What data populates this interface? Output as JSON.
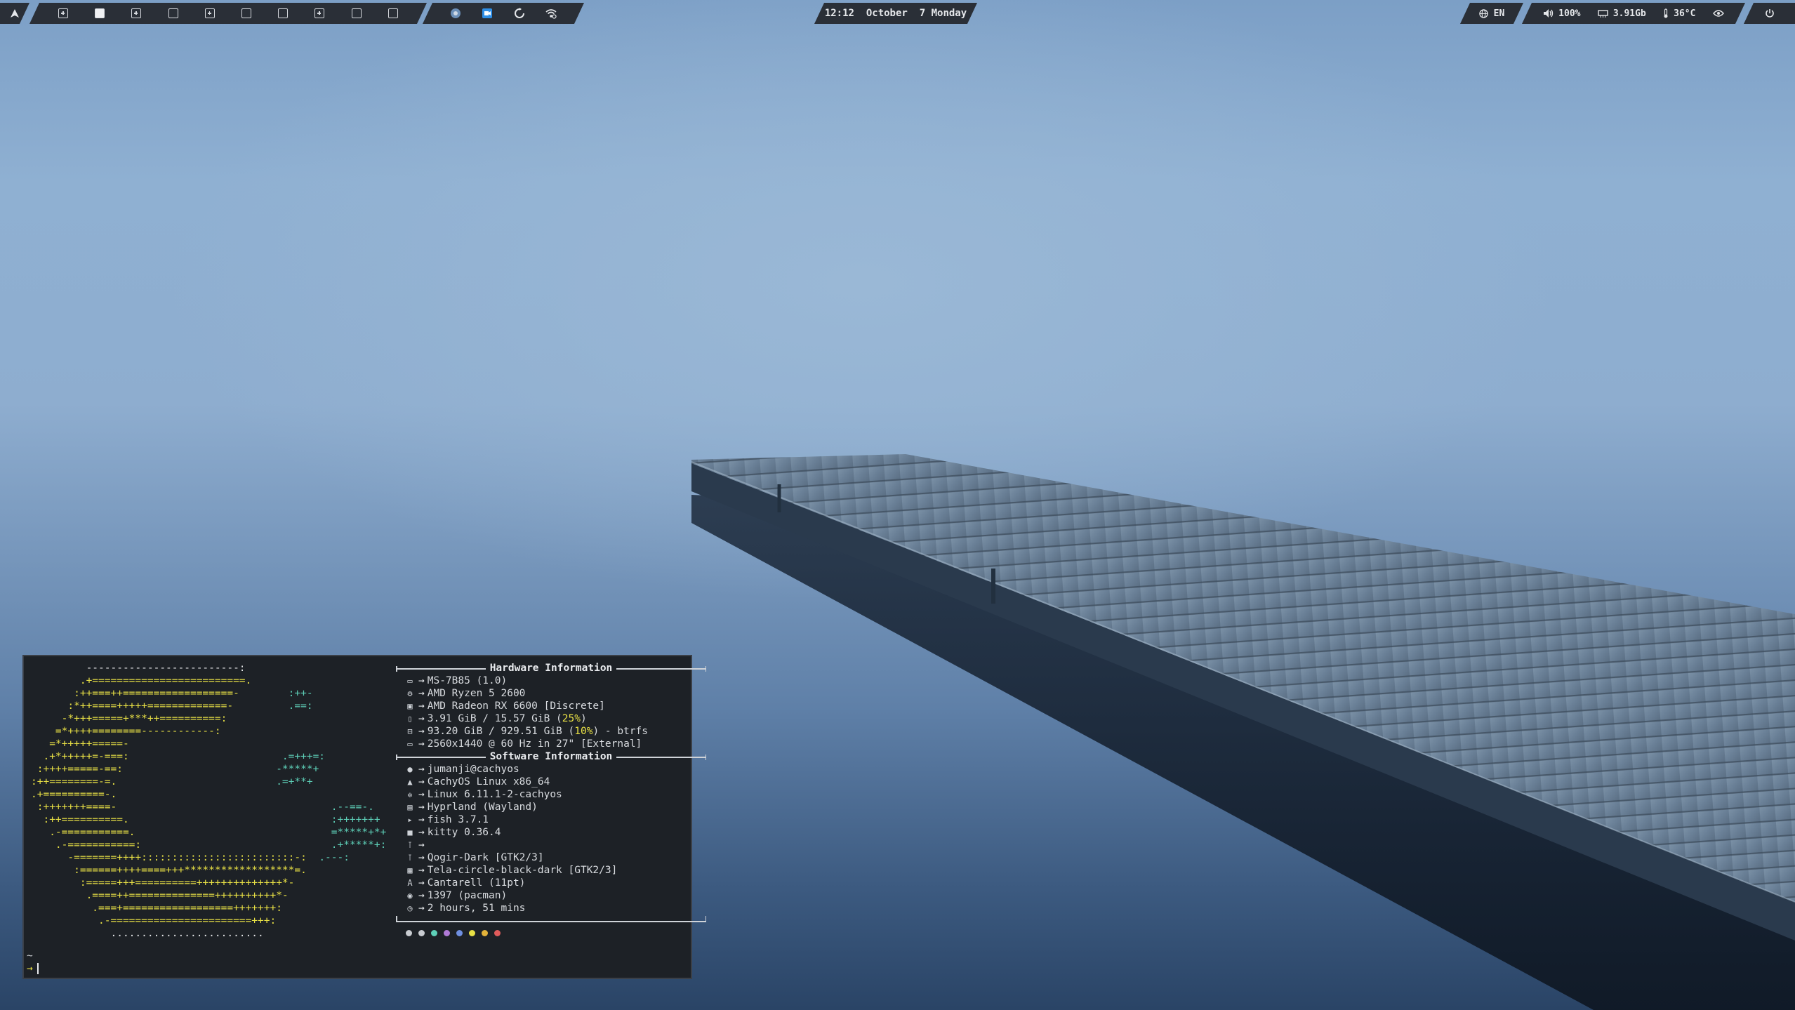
{
  "topbar": {
    "launcher_icon": "arch-logo-icon",
    "workspaces": [
      {
        "style": "plus",
        "active": false
      },
      {
        "style": "box",
        "active": true
      },
      {
        "style": "plus",
        "active": false
      },
      {
        "style": "box",
        "active": false
      },
      {
        "style": "plus",
        "active": false
      },
      {
        "style": "box",
        "active": false
      },
      {
        "style": "box",
        "active": false
      },
      {
        "style": "plus",
        "active": false
      },
      {
        "style": "box",
        "active": false
      },
      {
        "style": "box",
        "active": false
      }
    ],
    "tray_icons": [
      "browser-icon",
      "screen-recorder-icon",
      "power-restart-icon",
      "wifi-icon"
    ],
    "clock": {
      "time": "12:12",
      "month": "October",
      "day": "7",
      "weekday": "Monday"
    },
    "language": "EN",
    "volume": "100%",
    "memory": "3.91Gb",
    "temperature": "36°C",
    "power_icon": "power-icon"
  },
  "terminal": {
    "hardware_header": "Hardware Information",
    "software_header": "Software Information",
    "hardware": [
      {
        "icon": "laptop-icon",
        "text": "MS-7B85 (1.0)"
      },
      {
        "icon": "cpu-icon",
        "text": "AMD Ryzen 5 2600"
      },
      {
        "icon": "gpu-icon",
        "text": "AMD Radeon RX 6600 [Discrete]"
      },
      {
        "icon": "memory-icon",
        "pre": "3.91 GiB / 15.57 GiB (",
        "pct": "25%",
        "post": ")"
      },
      {
        "icon": "disk-icon",
        "pre": "93.20 GiB / 929.51 GiB (",
        "pct": "10%",
        "post": ") - btrfs"
      },
      {
        "icon": "monitor-icon",
        "text": "2560x1440 @ 60 Hz in 27\" [External]"
      }
    ],
    "software": [
      {
        "icon": "user-icon",
        "text": "jumanji@cachyos"
      },
      {
        "icon": "os-icon",
        "text": "CachyOS Linux x86_64"
      },
      {
        "icon": "kernel-gear-icon",
        "text": "Linux 6.11.1-2-cachyos"
      },
      {
        "icon": "window-manager-icon",
        "text": "Hyprland (Wayland)"
      },
      {
        "icon": "shell-icon",
        "text": "fish 3.7.1"
      },
      {
        "icon": "terminal-icon",
        "text": "kitty 0.36.4"
      },
      {
        "icon": "brush-icon",
        "text": ""
      },
      {
        "icon": "theme-brush-icon",
        "text": "Qogir-Dark [GTK2/3]"
      },
      {
        "icon": "icons-grid-icon",
        "text": "Tela-circle-black-dark [GTK2/3]"
      },
      {
        "icon": "font-icon",
        "text": "Cantarell (11pt)"
      },
      {
        "icon": "package-icon",
        "text": "1397 (pacman)"
      },
      {
        "icon": "clock-icon",
        "text": "2 hours, 51 mins"
      }
    ],
    "color_dots": [
      "#c9ccd1",
      "#c9ccd1",
      "#5ed0b8",
      "#b07ad6",
      "#6f8fe0",
      "#e8e045",
      "#e3b33a",
      "#e05b5b"
    ],
    "prompt_tilde": "~",
    "prompt_arrow": "→"
  }
}
